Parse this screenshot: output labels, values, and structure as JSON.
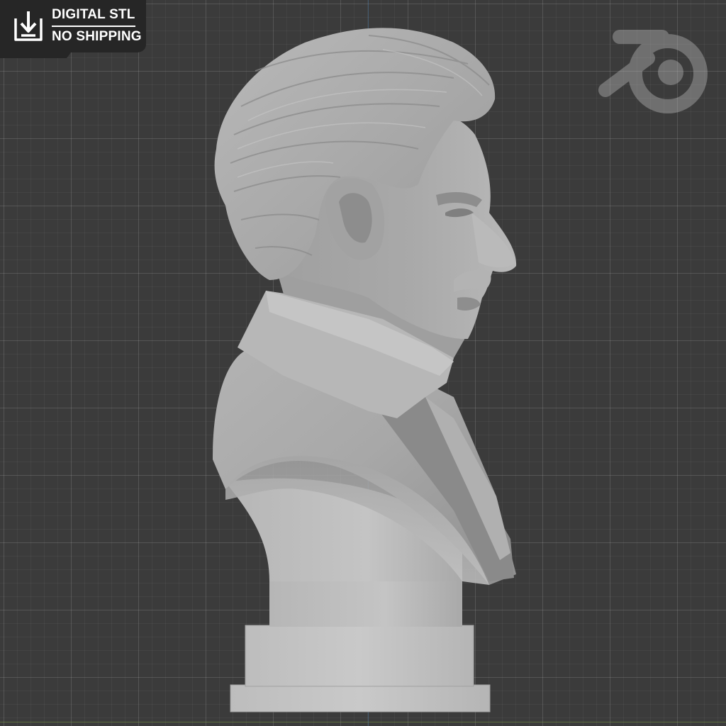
{
  "badge": {
    "line1": "DIGITAL STL",
    "line2": "NO SHIPPING",
    "icon": "download-icon",
    "background_color": "#262626",
    "text_color": "#ffffff"
  },
  "viewport": {
    "background_color": "#3b3b3b",
    "watermark_icon": "blender-logo-icon",
    "model": "bust-model"
  }
}
